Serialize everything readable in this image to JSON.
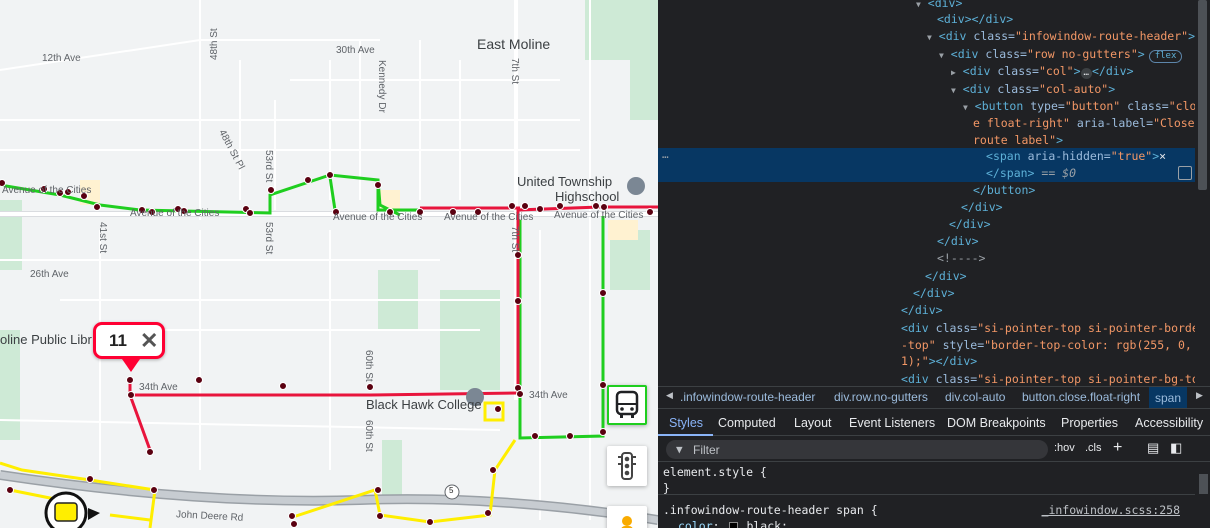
{
  "map": {
    "city_label": "East Moline",
    "poi": {
      "highschool_line1": "United Township",
      "highschool_line2": "Highschool",
      "college": "Black Hawk College",
      "library": "oline Public Libr"
    },
    "streets": {
      "s12th": "12th Ave",
      "s30th": "30th Ave",
      "s48th": "48th St",
      "s48thpl": "48th St Pl",
      "s53rd": "53rd St",
      "s53rd_b": "53rd St",
      "kennedy": "Kennedy Dr",
      "s7th": "7th St",
      "s7th_b": "7th St",
      "s41st": "41st St",
      "s26th": "26th Ave",
      "s34th_a": "34th Ave",
      "s34th_b": "34th Ave",
      "s60th_a": "60th St",
      "s60th_b": "60th St",
      "aoc_1": "Avenue of the Cities",
      "aoc_2": "Avenue of the Cities",
      "aoc_3": "Avenue of the Cities",
      "aoc_4": "Avenue of the Cities",
      "aoc_5": "Avenue of the Cities",
      "john_deere": "John Deere Rd",
      "hwy5": "5"
    },
    "route_popup": {
      "number": "11",
      "close": "✕"
    },
    "controls": [
      {
        "name": "transit-layer",
        "icon": "bus-icon"
      },
      {
        "name": "traffic-layer",
        "icon": "traffic-light-icon"
      },
      {
        "name": "street-view",
        "icon": "pegman-icon"
      }
    ],
    "colors": {
      "route_red": "#e8143c",
      "route_green": "#1fce1f",
      "route_yellow": "#ffee00",
      "stop": "#5a0010"
    }
  },
  "devtools": {
    "dom": {
      "l1": "<div>",
      "l2_open": "<div>",
      "l2_close": "</div>",
      "l3_tag": "div",
      "l3_attr": "class",
      "l3_val": "\"infowindow-route-header\"",
      "l4_tag": "div",
      "l4_attr": "class",
      "l4_val": "\"row no-gutters\"",
      "l4_badge": "flex",
      "l5_tag": "div",
      "l5_attr": "class",
      "l5_val": "\"col\"",
      "l5_pill": "…",
      "l6_tag": "div",
      "l6_attr": "class",
      "l6_val": "\"col-auto\"",
      "l7_tag": "button",
      "l7_a1": "type",
      "l7_v1": "\"button\"",
      "l7_a2": "class",
      "l7_v2a": "\"clos",
      "l7_v2b": "e float-right\"",
      "l7_a3": "aria-label",
      "l7_v3a": "\"Close",
      "l7_v3b": "route label\"",
      "l8_tag": "span",
      "l8_attr": "aria-hidden",
      "l8_val": "\"true\"",
      "l8_text": "×",
      "l9_close": "</span>",
      "l9_eq": "== $0",
      "l10": "</button>",
      "l11": "</div>",
      "l12": "</div>",
      "l13": "</div>",
      "l14": "<!---->",
      "l15": "</div>",
      "l16": "</div>",
      "l17": "</div>",
      "l18_tag": "div",
      "l18_attr1": "class",
      "l18_val1a": "\"si-pointer-top si-pointer-border",
      "l18_val1b": "-top\"",
      "l18_attr2": "style",
      "l18_val2a": "\"border-top-color: rgb(255, 0, 5",
      "l18_val2b": "1);\"",
      "l18_close": "></div>",
      "l19_tag": "div",
      "l19_attr": "class",
      "l19_val": "\"si-pointer-top si-pointer-bg-to",
      "gutter_dots": "…"
    },
    "breadcrumbs": [
      ".infowindow-route-header",
      "div.row.no-gutters",
      "div.col-auto",
      "button.close.float-right",
      "span"
    ],
    "tabs": [
      "Styles",
      "Computed",
      "Layout",
      "Event Listeners",
      "DOM Breakpoints",
      "Properties",
      "Accessibility"
    ],
    "filter": {
      "placeholder": "Filter",
      "hov": ":hov",
      "cls": ".cls"
    },
    "styles": {
      "element_style": "element.style {",
      "close_brace": "}",
      "rule_selector": ".infowindow-route-header span {",
      "rule_source": "_infowindow.scss:258",
      "prop_name": "color",
      "prop_value": "black;"
    }
  }
}
